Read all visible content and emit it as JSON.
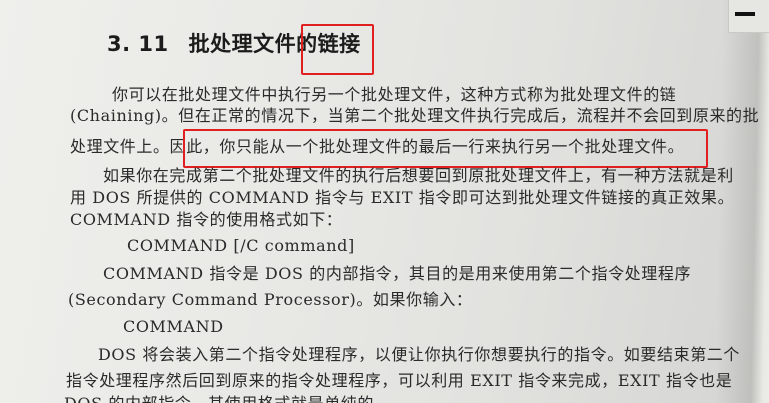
{
  "section": {
    "number": "3. 11",
    "title_pre": "批处理文件的",
    "title_highlight": "链接"
  },
  "lines": {
    "l1": "你可以在批处理文件中执行另一个批处理文件，这种方式称为批处理文件的链",
    "l2": "(Chaining)。但在正常的情况下，当第二个批处理文件执行完成后，流程并不会回到原来的批",
    "l3_pre": "处理文件上。",
    "l3_highlight": "因此，你只能从一个批处理文件的最后一行来执行另一个批处理文件。",
    "l4": "如果你在完成第二个批处理文件的执行后想要回到原批处理文件上，有一种方法就是利",
    "l5": "用 DOS 所提供的 COMMAND 指令与 EXIT 指令即可达到批处理文件链接的真正效果。",
    "l6": "COMMAND 指令的使用格式如下：",
    "l7": "COMMAND [/C command]",
    "l8": "COMMAND 指令是 DOS 的内部指令，其目的是用来使用第二个指令处理程序",
    "l9": "(Secondary Command Processor)。如果你输入：",
    "l10": "COMMAND",
    "l11": "DOS 将会装入第二个指令处理程序，以便让你执行你想要执行的指令。如要结束第二个",
    "l12": "指令处理程序然后回到原来的指令处理程序，可以利用 EXIT 指令来完成，EXIT 指令也是",
    "l13": "DOS 的内部指令，其使用格式就是单纯的"
  },
  "colors": {
    "highlight_box": "#e02020",
    "ink": "#2a2a2a"
  }
}
